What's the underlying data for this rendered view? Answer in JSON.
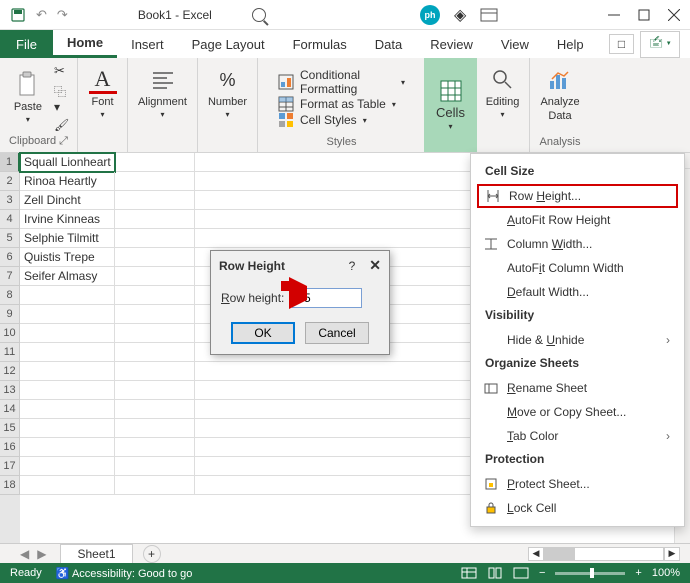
{
  "titlebar": {
    "title": "Book1 - Excel",
    "logo_text": "ph"
  },
  "tabs": {
    "file": "File",
    "home": "Home",
    "insert": "Insert",
    "page_layout": "Page Layout",
    "formulas": "Formulas",
    "data": "Data",
    "review": "Review",
    "view": "View",
    "help": "Help"
  },
  "ribbon": {
    "clipboard": {
      "paste": "Paste",
      "label": "Clipboard"
    },
    "font": {
      "label": "Font"
    },
    "alignment": {
      "label": "Alignment"
    },
    "number": {
      "label": "Number"
    },
    "styles": {
      "conditional": "Conditional Formatting",
      "table": "Format as Table",
      "cellstyles": "Cell Styles",
      "label": "Styles"
    },
    "cells": {
      "label": "Cells"
    },
    "editing": {
      "label": "Editing"
    },
    "analyze": {
      "big": "Analyze",
      "sub": "Data",
      "label": "Analysis"
    }
  },
  "sheet": {
    "rows": [
      "Squall Lionheart",
      "Rinoa Heartly",
      "Zell Dincht",
      "Irvine Kinneas",
      "Selphie Tilmitt",
      "Quistis Trepe",
      "Seifer Almasy"
    ],
    "row_numbers": [
      "1",
      "2",
      "3",
      "4",
      "5",
      "6",
      "7",
      "8",
      "9",
      "10",
      "11",
      "12",
      "13",
      "14",
      "15",
      "16",
      "17",
      "18"
    ],
    "tab_name": "Sheet1"
  },
  "dialog": {
    "title": "Row Height",
    "label": "Row height:",
    "value": "45",
    "ok": "OK",
    "cancel": "Cancel"
  },
  "dropdown": {
    "cell_size": "Cell Size",
    "row_height": "Row Height...",
    "autofit_row": "AutoFit Row Height",
    "col_width": "Column Width...",
    "autofit_col": "AutoFit Column Width",
    "default_width": "Default Width...",
    "visibility": "Visibility",
    "hide_unhide": "Hide & Unhide",
    "organize": "Organize Sheets",
    "rename": "Rename Sheet",
    "move_copy": "Move or Copy Sheet...",
    "tab_color": "Tab Color",
    "protection": "Protection",
    "protect_sheet": "Protect Sheet...",
    "lock_cell": "Lock Cell"
  },
  "statusbar": {
    "ready": "Ready",
    "accessibility": "Accessibility: Good to go",
    "zoom": "100%"
  }
}
